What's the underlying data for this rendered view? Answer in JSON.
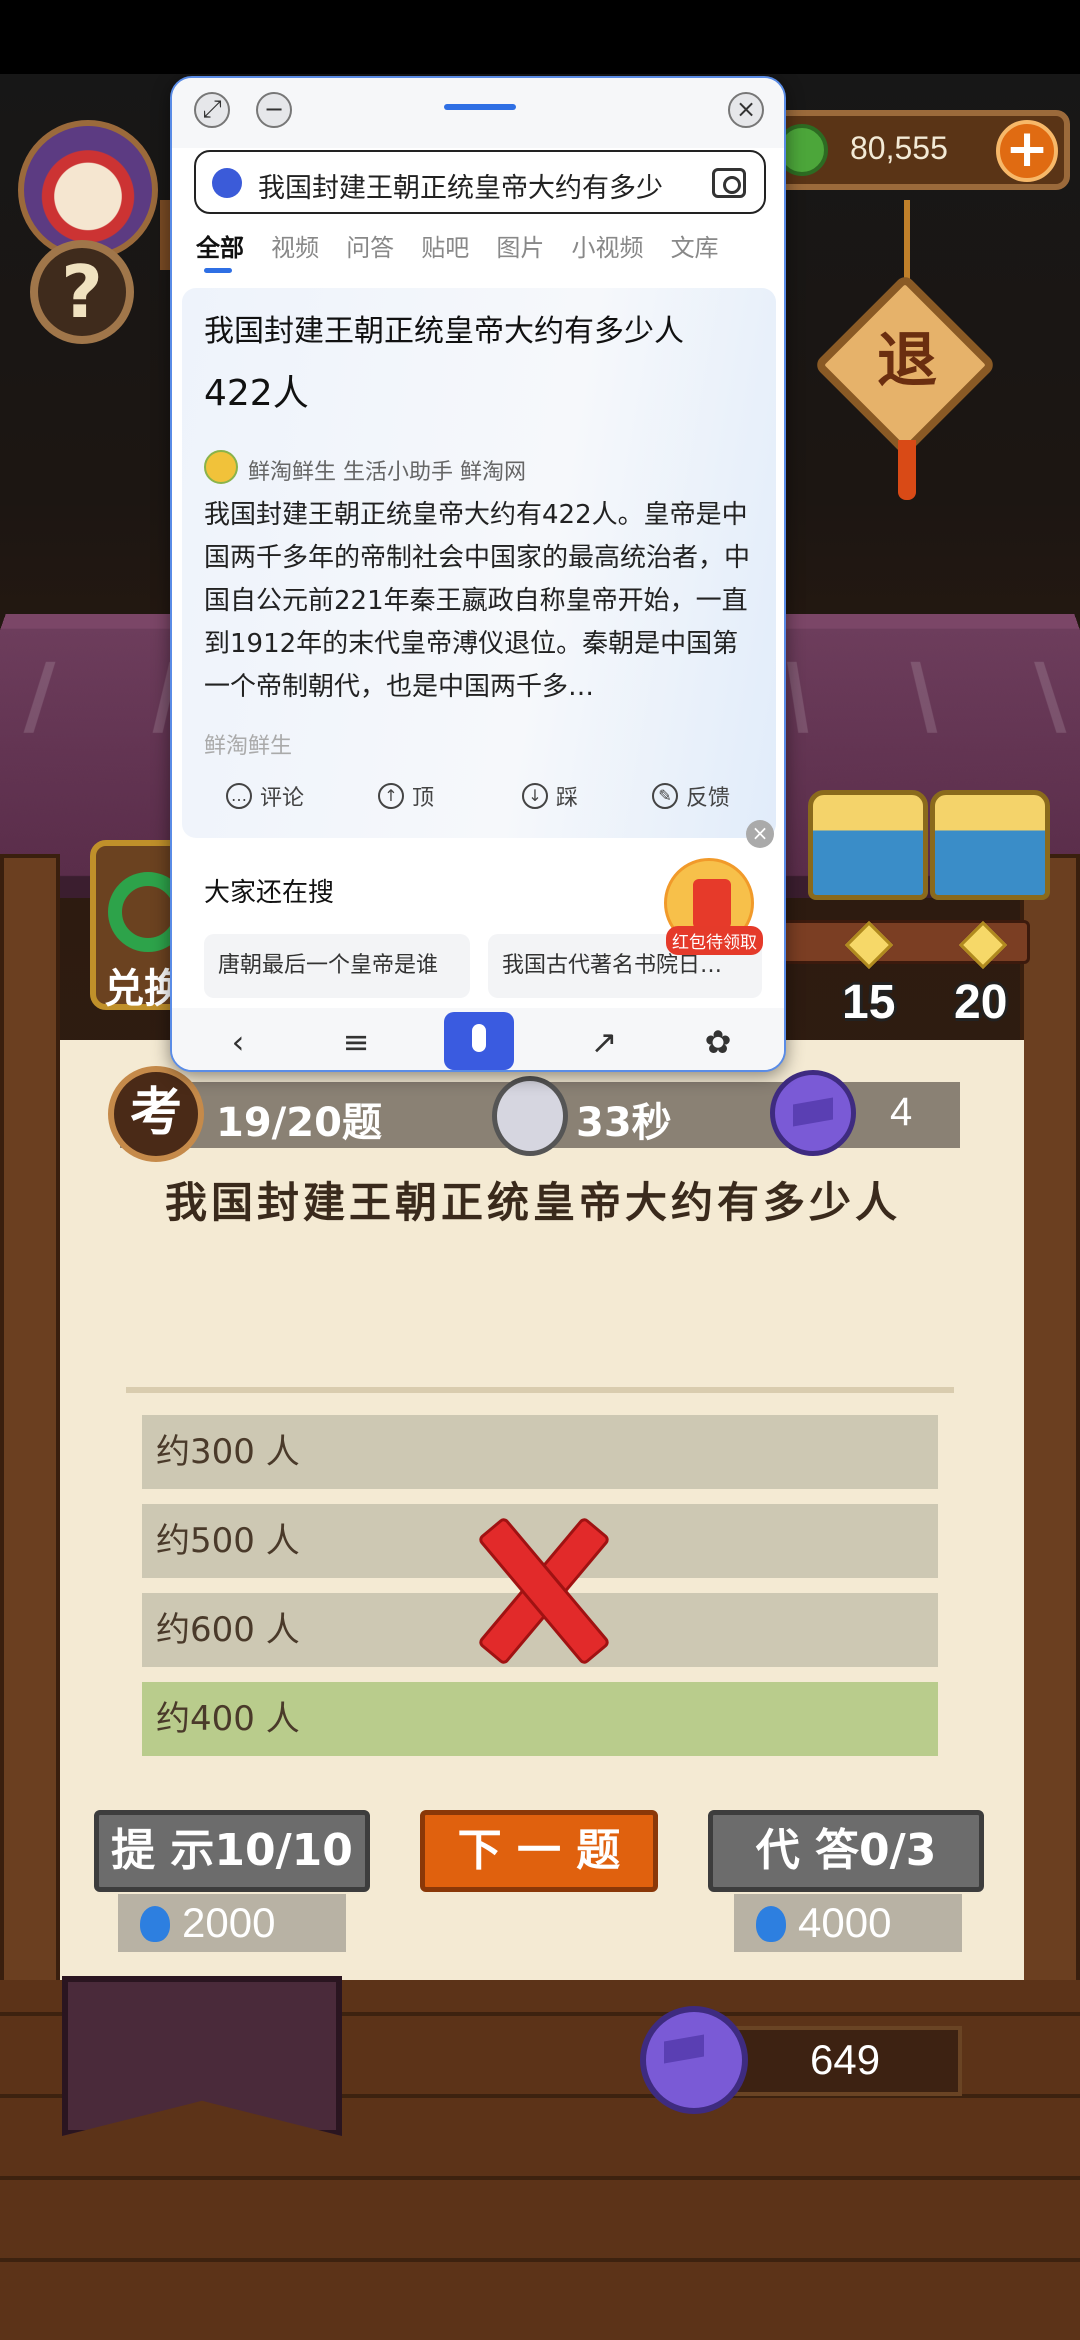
{
  "game": {
    "coins": "80,555",
    "exit_label": "退",
    "help_label": "?",
    "exchange_label": "兑换",
    "chest_rewards": [
      "15",
      "20"
    ],
    "quiz": {
      "kao_label": "考",
      "progress": "19/20题",
      "timer": "33秒",
      "caps": "4",
      "question": "我国封建王朝正统皇帝大约有多少人",
      "options": [
        "约300 人",
        "约500 人",
        "约600 人",
        "约400 人"
      ],
      "correct_index": 3,
      "wrong_index": 1
    },
    "buttons": {
      "hint": "提 示10/10",
      "next": "下 一 题",
      "agent": "代 答0/3",
      "hint_cost": "2000",
      "agent_cost": "4000"
    },
    "bottom_score": "649"
  },
  "search_window": {
    "query": "我国封建王朝正统皇帝大约有多少",
    "tabs": [
      "全部",
      "视频",
      "问答",
      "贴吧",
      "图片",
      "小视频",
      "文库"
    ],
    "active_tab": 0,
    "card": {
      "title": "我国封建王朝正统皇帝大约有多少人",
      "answer": "422人",
      "source": "鲜淘鲜生 生活小助手 鲜淘网",
      "body": "我国封建王朝正统皇帝大约有422人。皇帝是中国两千多年的帝制社会中国家的最高统治者，中国自公元前221年秦王嬴政自称皇帝开始，一直到1912年的末代皇帝溥仪退位。秦朝是中国第一个帝制朝代，也是中国两千多…",
      "source_footer": "鲜淘鲜生",
      "actions": [
        "评论",
        "顶",
        "踩",
        "反馈"
      ]
    },
    "others": {
      "title": "大家还在搜",
      "chips": [
        "唐朝最后一个皇帝是谁",
        "我国古代著名书院日…"
      ],
      "red_packet_label": "红包待领取"
    }
  }
}
